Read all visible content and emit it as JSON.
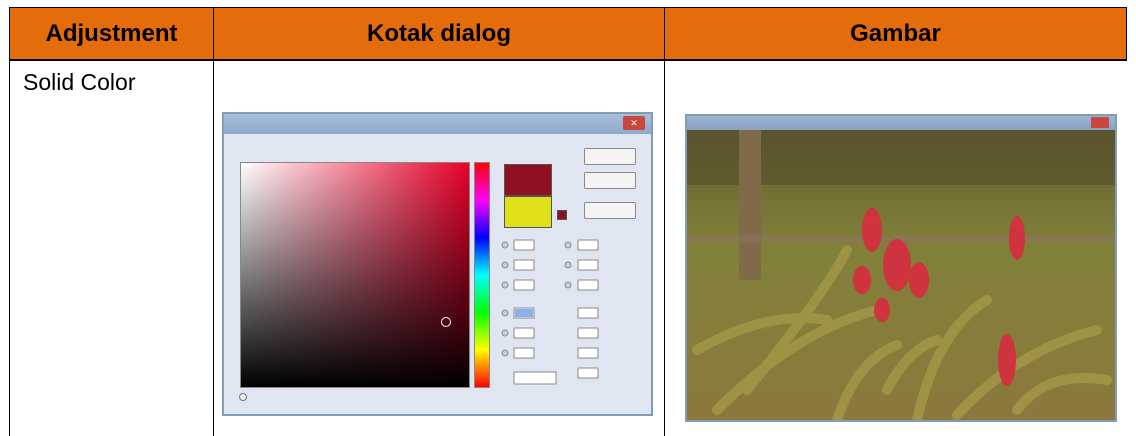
{
  "table": {
    "headers": [
      "Adjustment",
      "Kotak dialog",
      "Gambar"
    ],
    "row1": {
      "adjustment": "Solid Color"
    }
  },
  "colors": {
    "header_bg": "#e46c0a",
    "new_color": "#8f1020",
    "old_color": "#dfe01a"
  },
  "icons": [
    "close-icon",
    "radio-icon"
  ]
}
